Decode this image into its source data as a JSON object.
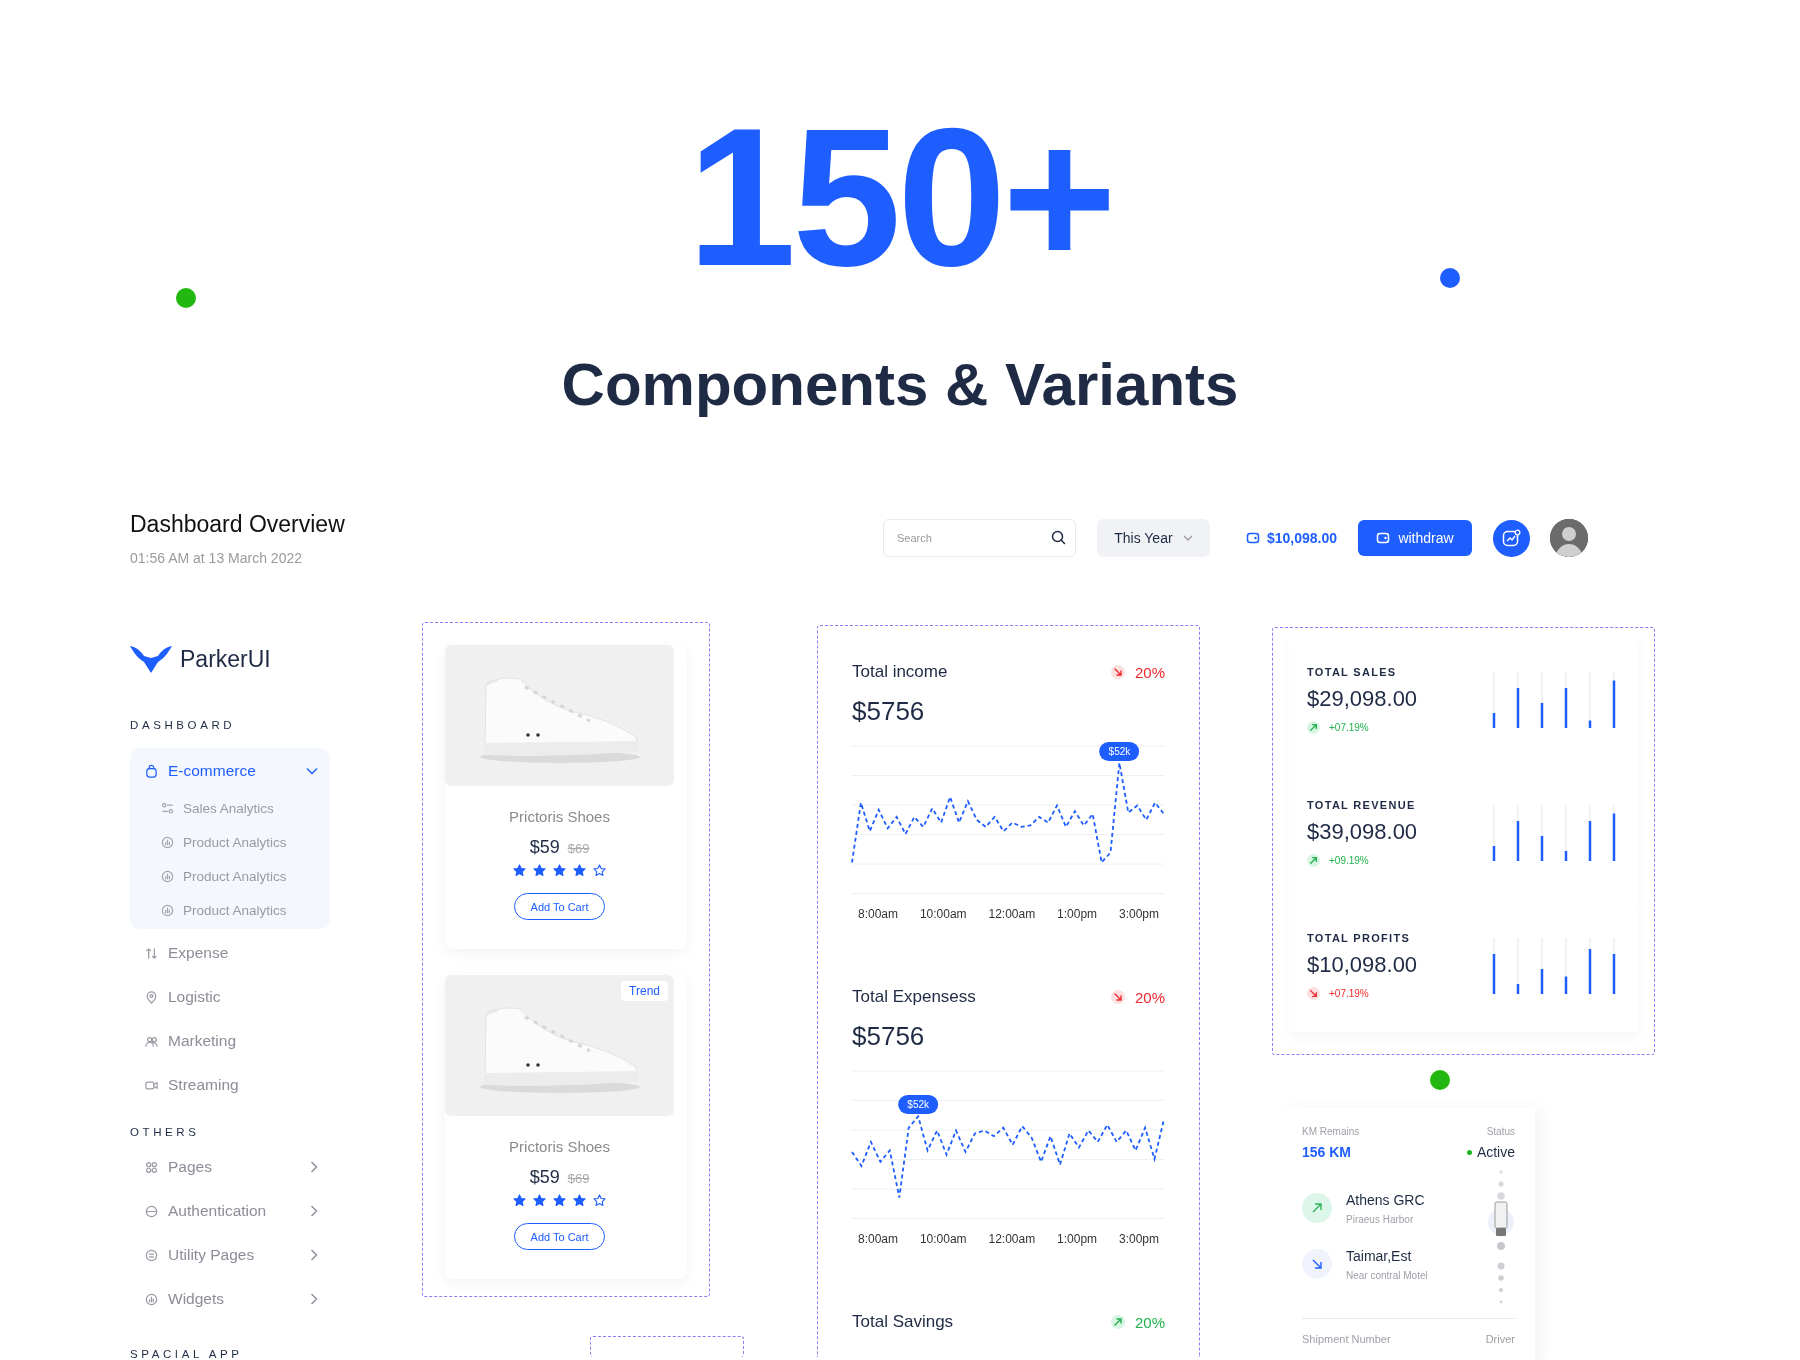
{
  "hero": {
    "headline": "150+",
    "subtitle": "Components & Variants"
  },
  "header": {
    "title": "Dashboard Overview",
    "timestamp": "01:56 AM at 13 March 2022",
    "search": {
      "placeholder": "Search"
    },
    "period": "This Year",
    "balance": "$10,098.00",
    "withdraw": "withdraw"
  },
  "sidebar": {
    "brand": "ParkerUI",
    "sections": [
      {
        "title": "DASHBOARD",
        "items": [
          {
            "label": "E-commerce",
            "kind": "group",
            "selected": true,
            "expanded": true,
            "children": [
              {
                "label": "Sales Analytics",
                "selected": false
              },
              {
                "label": "Product Analytics",
                "selected": false
              },
              {
                "label": "Product Analytics",
                "selected": false
              },
              {
                "label": "Product Analytics",
                "selected": false
              }
            ]
          },
          {
            "label": "Expense",
            "kind": "link",
            "selected": false
          },
          {
            "label": "Logistic",
            "kind": "link",
            "selected": false
          },
          {
            "label": "Marketing",
            "kind": "link",
            "selected": false
          },
          {
            "label": "Streaming",
            "kind": "link",
            "selected": false
          }
        ]
      },
      {
        "title": "OTHERS",
        "items": [
          {
            "label": "Pages",
            "kind": "group",
            "selected": false,
            "expanded": false
          },
          {
            "label": "Authentication",
            "kind": "group",
            "selected": false,
            "expanded": false
          },
          {
            "label": "Utility Pages",
            "kind": "group",
            "selected": false,
            "expanded": false
          },
          {
            "label": "Widgets",
            "kind": "group",
            "selected": false,
            "expanded": false
          }
        ]
      },
      {
        "title": "SPACIAL APP"
      }
    ]
  },
  "products": [
    {
      "name": "Prictoris Shoes",
      "price": "$59",
      "old_price": "$69",
      "stars": 4,
      "button": "Add To Cart"
    },
    {
      "name": "Prictoris Shoes",
      "price": "$59",
      "old_price": "$69",
      "stars": 4,
      "button": "Add To Cart",
      "badge": "Trend"
    }
  ],
  "metrics": [
    {
      "title": "Total income",
      "value": "$5756",
      "change": "20%",
      "rising": false,
      "tooltip": "$52k",
      "x_labels": [
        "8:00am",
        "10:00am",
        "12:00am",
        "1:00pm",
        "3:00pm"
      ]
    },
    {
      "title": "Total Expensess",
      "value": "$5756",
      "change": "20%",
      "rising": false,
      "tooltip": "$52k",
      "x_labels": [
        "8:00am",
        "10:00am",
        "12:00am",
        "1:00pm",
        "3:00pm"
      ]
    },
    {
      "title": "Total Savings",
      "change": "20%",
      "rising": true
    }
  ],
  "stats": [
    {
      "title": "TOTAL SALES",
      "value": "$29,098.00",
      "change": "+07.19%",
      "rising": true
    },
    {
      "title": "TOTAL REVENUE",
      "value": "$39,098.00",
      "change": "+09.19%",
      "rising": true
    },
    {
      "title": "TOTAL PROFITS",
      "value": "$10,098.00",
      "change": "+07.19%",
      "rising": false
    }
  ],
  "shipment": {
    "km_label": "KM Remains",
    "km_value": "156 KM",
    "status_label": "Status",
    "status": "Active",
    "color": "#1fb31f",
    "stops": [
      {
        "name": "Athens GRC",
        "place": "Piraeus Harbor",
        "kind": "origin"
      },
      {
        "name": "Taimar,Est",
        "place": "Near contral Motel",
        "kind": "destination"
      }
    ],
    "number_label": "Shipment Number",
    "driver_label": "Driver"
  }
}
